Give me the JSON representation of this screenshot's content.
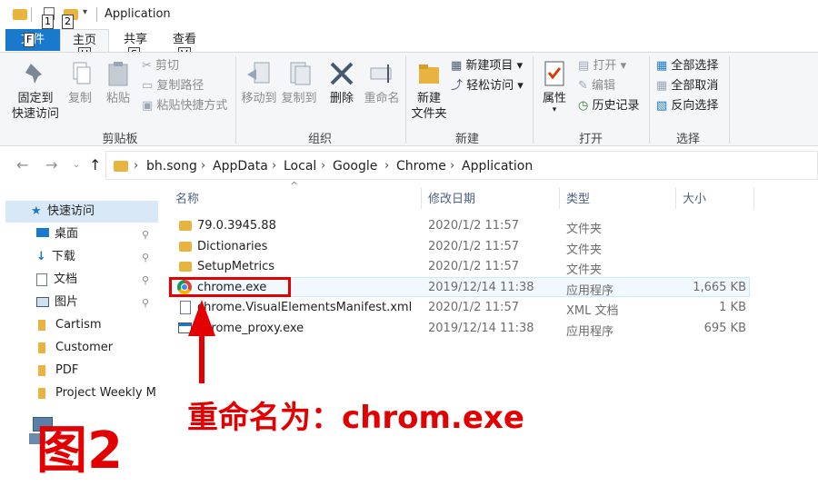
{
  "window": {
    "title": "Application"
  },
  "quick_access": {
    "keytips": [
      "1",
      "2"
    ]
  },
  "tabs": [
    {
      "label": "文件",
      "keytip": "F"
    },
    {
      "label": "主页",
      "keytip": "H"
    },
    {
      "label": "共享",
      "keytip": "S"
    },
    {
      "label": "查看",
      "keytip": "V"
    }
  ],
  "ribbon": {
    "clipboard": {
      "pin_label": "固定到\n快速访问",
      "pin_line1": "固定到",
      "pin_line2": "快速访问",
      "copy": "复制",
      "paste": "粘贴",
      "cut": "剪切",
      "copy_path": "复制路径",
      "paste_shortcut": "粘贴快捷方式",
      "group": "剪贴板"
    },
    "organize": {
      "move_to": "移动到",
      "copy_to": "复制到",
      "delete": "删除",
      "rename": "重命名",
      "group": "组织"
    },
    "new": {
      "new_folder_line1": "新建",
      "new_folder_line2": "文件夹",
      "new_item": "新建项目",
      "easy_access": "轻松访问",
      "group": "新建"
    },
    "open": {
      "properties": "属性",
      "open": "打开",
      "edit": "编辑",
      "history": "历史记录",
      "group": "打开"
    },
    "select": {
      "select_all": "全部选择",
      "select_none": "全部取消",
      "invert": "反向选择",
      "group": "选择"
    }
  },
  "address": {
    "crumbs": [
      "bh.song",
      "AppData",
      "Local",
      "Google",
      "Chrome",
      "Application"
    ]
  },
  "nav": {
    "quick_access": "快速访问",
    "items": [
      "桌面",
      "下载",
      "文档",
      "图片",
      "Cartism",
      "Customer",
      "PDF",
      "Project Weekly M"
    ]
  },
  "columns": {
    "name": "名称",
    "date": "修改日期",
    "type": "类型",
    "size": "大小"
  },
  "files": [
    {
      "name": "79.0.3945.88",
      "date": "2020/1/2 11:57",
      "type": "文件夹",
      "size": ""
    },
    {
      "name": "Dictionaries",
      "date": "2020/1/2 11:57",
      "type": "文件夹",
      "size": ""
    },
    {
      "name": "SetupMetrics",
      "date": "2020/1/2 11:57",
      "type": "文件夹",
      "size": ""
    },
    {
      "name": "chrome.exe",
      "date": "2019/12/14 11:38",
      "type": "应用程序",
      "size": "1,665 KB"
    },
    {
      "name": "chrome.VisualElementsManifest.xml",
      "date": "2020/1/2 11:57",
      "type": "XML 文档",
      "size": "1 KB"
    },
    {
      "name": "chrome_proxy.exe",
      "date": "2019/12/14 11:38",
      "type": "应用程序",
      "size": "695 KB"
    }
  ],
  "annotation": {
    "note": "重命名为：chrom.exe",
    "figure": "图2",
    "color": "#e30000"
  }
}
